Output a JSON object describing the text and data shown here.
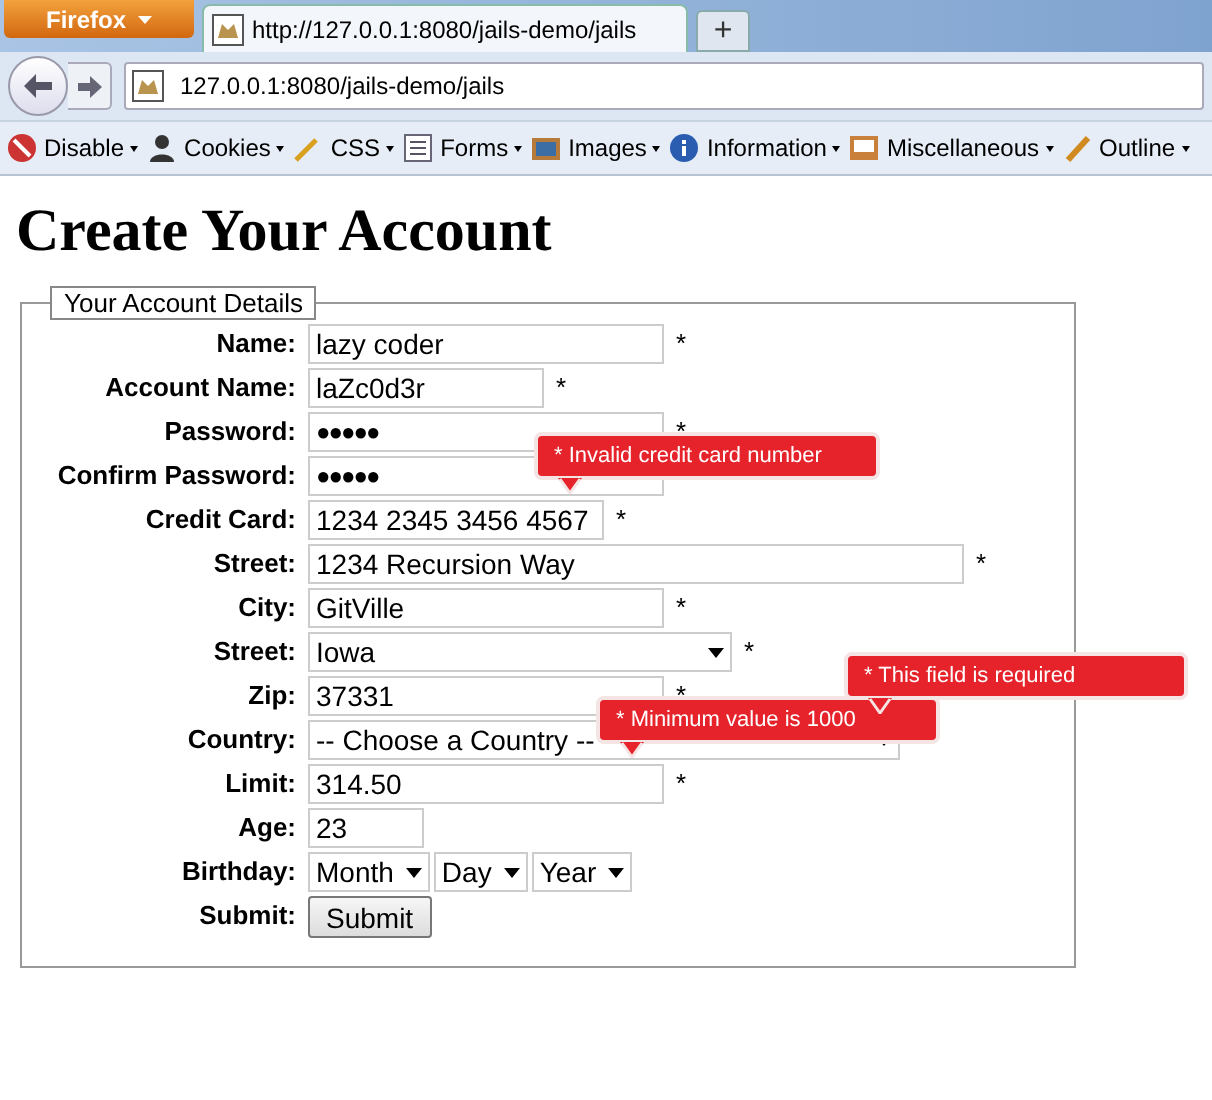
{
  "browser": {
    "menu_button": "Firefox",
    "tab_title": "http://127.0.0.1:8080/jails-demo/jails",
    "new_tab": "+",
    "address": "127.0.0.1:8080/jails-demo/jails"
  },
  "toolbar": [
    "Disable",
    "Cookies",
    "CSS",
    "Forms",
    "Images",
    "Information",
    "Miscellaneous",
    "Outline"
  ],
  "page": {
    "heading": "Create Your Account",
    "legend": "Your Account Details",
    "fields": [
      {
        "label": "Name:",
        "kind": "text",
        "value": "lazy coder",
        "mark": "*"
      },
      {
        "label": "Account Name:",
        "kind": "text",
        "value": "laZc0d3r",
        "mark": "*"
      },
      {
        "label": "Password:",
        "kind": "password",
        "value": "●●●●●",
        "mark": "*"
      },
      {
        "label": "Confirm Password:",
        "kind": "password",
        "value": "●●●●●"
      },
      {
        "label": "Credit Card:",
        "kind": "text",
        "value": "1234 2345 3456 4567",
        "mark": "*",
        "error": "* Invalid credit card number"
      },
      {
        "label": "Street:",
        "kind": "text",
        "value": "1234 Recursion Way",
        "mark": "*"
      },
      {
        "label": "City:",
        "kind": "text",
        "value": "GitVille",
        "mark": "*"
      },
      {
        "label": "Street:",
        "kind": "select",
        "value": "Iowa",
        "mark": "*"
      },
      {
        "label": "Zip:",
        "kind": "text",
        "value": "37331",
        "mark": "*"
      },
      {
        "label": "Country:",
        "kind": "select",
        "value": "-- Choose a Country --",
        "error": "* This field is required"
      },
      {
        "label": "Limit:",
        "kind": "text",
        "value": "314.50",
        "mark": "*",
        "error": "* Minimum value is 1000"
      },
      {
        "label": "Age:",
        "kind": "text",
        "value": "23"
      },
      {
        "label": "Birthday:",
        "kind": "selects",
        "values": [
          "Month",
          "Day",
          "Year"
        ]
      },
      {
        "label": "Submit:",
        "kind": "button",
        "value": "Submit"
      }
    ]
  }
}
